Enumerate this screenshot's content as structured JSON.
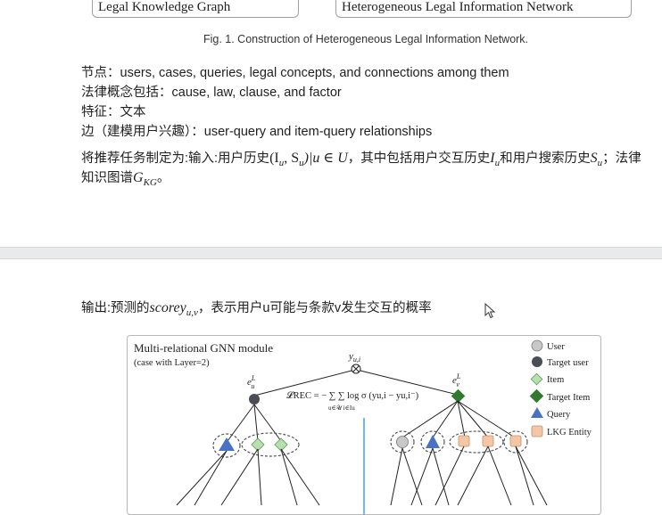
{
  "figure_top": {
    "left_box": "Legal Knowledge Graph",
    "right_box": "Heterogeneous Legal Information Network",
    "caption": "Fig. 1.  Construction of Heterogeneous Legal Information Network."
  },
  "notes": {
    "nodes": "节点：users, cases, queries, legal concepts, and connections among them",
    "legal_concepts": "法律概念包括：cause, law, clause, and factor",
    "features": "特征：文本",
    "edges": "边（建模用户兴趣）：user-query and item-query relationships"
  },
  "task": {
    "t1": "将推荐任务制定为:输入:用户历史",
    "m1": "(I",
    "m1s": "u",
    "m2": ", S",
    "m2s": "u",
    "m3": ")|u ∈ U",
    "t2": "，其中包括用户交互历史",
    "m4": "I",
    "m4s": "u",
    "t3": "和用户搜索历史",
    "m5": "S",
    "m5s": "u",
    "t4": "；法律",
    "t5": "知识图谱",
    "m6": "G",
    "m6s": "KG",
    "t6": "。"
  },
  "output": {
    "t1": "输出:预测的",
    "m1": "scorey",
    "m1s": "u,v",
    "t2": "，表示用户u可能与条款v发生交互的概率"
  },
  "diagram": {
    "title": "Multi-relational GNN module",
    "subtitle": "(case with Layer=2)",
    "y_label": "y",
    "y_sub": "u,i",
    "eu": "e",
    "eu_sub": "u",
    "eu_sup": "L",
    "ev": "e",
    "ev_sub": "v",
    "ev_sup": "L",
    "loss": "𝓛REC = − ∑  ∑  log σ (yu,i − yu,i⁻)",
    "loss_under": "u∈𝒰  i∈Iu",
    "legend": [
      "User",
      "Target user",
      "Item",
      "Target Item",
      "Query",
      "LKG Entity"
    ]
  },
  "colors": {
    "query_blue": "#4a72c4",
    "item_green": "#b9dfb1",
    "target_green": "#2f7a2f",
    "entity_orange": "#f3c6a5",
    "user_gray": "#c8c8c8",
    "target_user": "#4a4d55",
    "divider_blue": "#3ea0e8"
  }
}
